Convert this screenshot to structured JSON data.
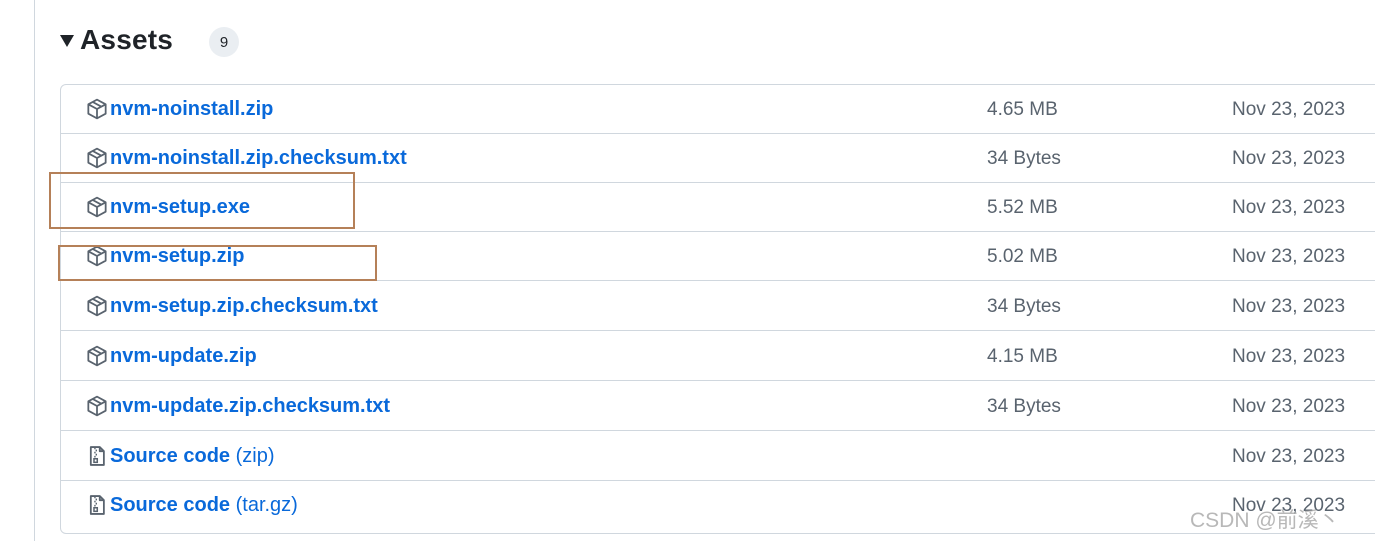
{
  "section": {
    "title": "Assets",
    "count": "9"
  },
  "assets": [
    {
      "name": "nvm-noinstall.zip",
      "suffix": "",
      "size": "4.65 MB",
      "date": "Nov 23, 2023",
      "icon": "package-icon"
    },
    {
      "name": "nvm-noinstall.zip.checksum.txt",
      "suffix": "",
      "size": "34 Bytes",
      "date": "Nov 23, 2023",
      "icon": "package-icon"
    },
    {
      "name": "nvm-setup.exe",
      "suffix": "",
      "size": "5.52 MB",
      "date": "Nov 23, 2023",
      "icon": "package-icon"
    },
    {
      "name": "nvm-setup.zip",
      "suffix": "",
      "size": "5.02 MB",
      "date": "Nov 23, 2023",
      "icon": "package-icon"
    },
    {
      "name": "nvm-setup.zip.checksum.txt",
      "suffix": "",
      "size": "34 Bytes",
      "date": "Nov 23, 2023",
      "icon": "package-icon"
    },
    {
      "name": "nvm-update.zip",
      "suffix": "",
      "size": "4.15 MB",
      "date": "Nov 23, 2023",
      "icon": "package-icon"
    },
    {
      "name": "nvm-update.zip.checksum.txt",
      "suffix": "",
      "size": "34 Bytes",
      "date": "Nov 23, 2023",
      "icon": "package-icon"
    },
    {
      "name": "Source code",
      "suffix": " (zip)",
      "size": "",
      "date": "Nov 23, 2023",
      "icon": "file-zip-icon"
    },
    {
      "name": "Source code",
      "suffix": " (tar.gz)",
      "size": "",
      "date": "Nov 23, 2023",
      "icon": "file-zip-icon"
    }
  ],
  "watermark": "CSDN @前溪丶",
  "colors": {
    "link": "#0969da",
    "highlight_border": "#b58058",
    "muted_text": "#59636e",
    "border": "#d0d7de"
  }
}
